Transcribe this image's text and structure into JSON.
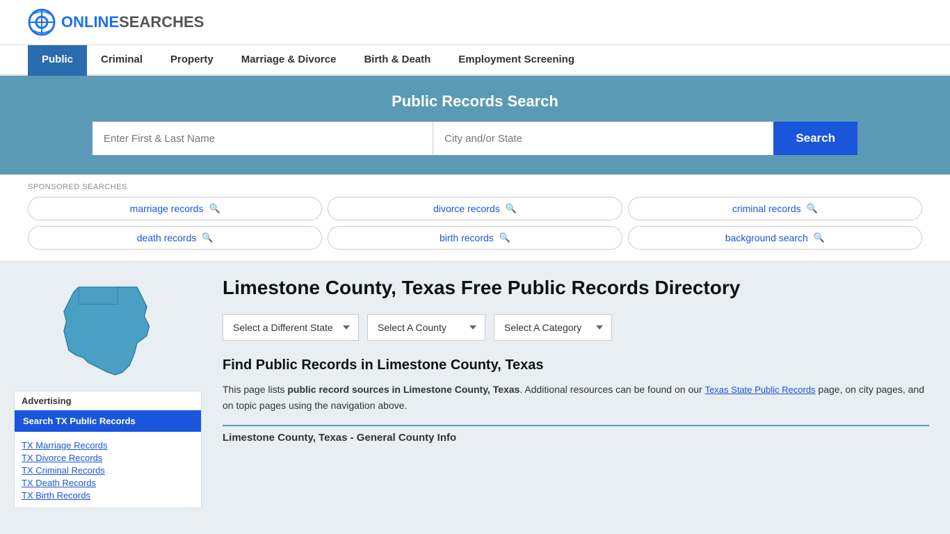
{
  "logo": {
    "icon_label": "online-searches-logo-icon",
    "brand_prefix": "ONLINE",
    "brand_suffix": "SEARCHES"
  },
  "nav": {
    "items": [
      {
        "id": "public",
        "label": "Public",
        "active": true
      },
      {
        "id": "criminal",
        "label": "Criminal",
        "active": false
      },
      {
        "id": "property",
        "label": "Property",
        "active": false
      },
      {
        "id": "marriage-divorce",
        "label": "Marriage & Divorce",
        "active": false
      },
      {
        "id": "birth-death",
        "label": "Birth & Death",
        "active": false
      },
      {
        "id": "employment",
        "label": "Employment Screening",
        "active": false
      }
    ]
  },
  "search_banner": {
    "title": "Public Records Search",
    "name_placeholder": "Enter First & Last Name",
    "location_placeholder": "City and/or State",
    "search_button_label": "Search"
  },
  "sponsored": {
    "label": "SPONSORED SEARCHES",
    "tags": [
      {
        "id": "marriage-records",
        "label": "marriage records"
      },
      {
        "id": "divorce-records",
        "label": "divorce records"
      },
      {
        "id": "criminal-records",
        "label": "criminal records"
      },
      {
        "id": "death-records",
        "label": "death records"
      },
      {
        "id": "birth-records",
        "label": "birth records"
      },
      {
        "id": "background-search",
        "label": "background search"
      }
    ]
  },
  "sidebar": {
    "advertising_label": "Advertising",
    "ad_button_label": "Search TX Public Records",
    "ad_links": [
      {
        "id": "tx-marriage",
        "label": "TX Marriage Records"
      },
      {
        "id": "tx-divorce",
        "label": "TX Divorce Records"
      },
      {
        "id": "tx-criminal",
        "label": "TX Criminal Records"
      },
      {
        "id": "tx-death",
        "label": "TX Death Records"
      },
      {
        "id": "tx-birth",
        "label": "TX Birth Records"
      }
    ]
  },
  "main": {
    "page_title": "Limestone County, Texas Free Public Records Directory",
    "dropdowns": {
      "state_placeholder": "Select a Different State",
      "county_placeholder": "Select A County",
      "category_placeholder": "Select A Category"
    },
    "find_records_title": "Find Public Records in Limestone County, Texas",
    "description_part1": "This page lists ",
    "description_bold": "public record sources in Limestone County, Texas",
    "description_part2": ". Additional resources can be found on our ",
    "description_link_text": "Texas State Public Records",
    "description_part3": " page, on city pages, and on topic pages using the navigation above.",
    "general_info_title": "Limestone County, Texas - General County Info"
  }
}
